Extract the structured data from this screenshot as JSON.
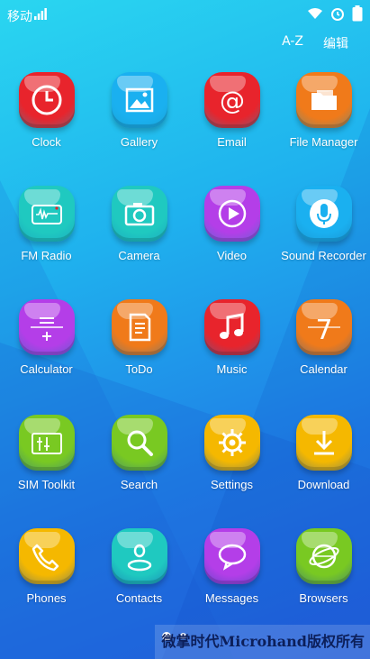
{
  "status_bar": {
    "carrier": "移动",
    "icons": [
      "signal-icon",
      "wifi-icon",
      "alarm-icon",
      "battery-icon"
    ]
  },
  "header": {
    "sort_label": "A-Z",
    "edit_label": "编辑"
  },
  "apps": [
    {
      "label": "Clock",
      "color": "#e8242c",
      "icon": "clock-icon"
    },
    {
      "label": "Gallery",
      "color": "#1ab0f0",
      "icon": "gallery-icon"
    },
    {
      "label": "Email",
      "color": "#e8242c",
      "icon": "email-icon"
    },
    {
      "label": "File Manager",
      "color": "#f07a1a",
      "icon": "folder-icon"
    },
    {
      "label": "FM Radio",
      "color": "#1fc9c0",
      "icon": "radio-icon"
    },
    {
      "label": "Camera",
      "color": "#1fc9c0",
      "icon": "camera-icon"
    },
    {
      "label": "Video",
      "color": "#b43ee8",
      "icon": "play-icon"
    },
    {
      "label": "Sound Recorder",
      "color": "#1ab0f0",
      "icon": "microphone-icon"
    },
    {
      "label": "Calculator",
      "color": "#b43ee8",
      "icon": "calculator-icon"
    },
    {
      "label": "ToDo",
      "color": "#f07a1a",
      "icon": "note-icon"
    },
    {
      "label": "Music",
      "color": "#e8242c",
      "icon": "music-icon"
    },
    {
      "label": "Calendar",
      "color": "#f07a1a",
      "icon": "calendar-icon"
    },
    {
      "label": "SIM Toolkit",
      "color": "#79c922",
      "icon": "sim-icon"
    },
    {
      "label": "Search",
      "color": "#79c922",
      "icon": "search-icon"
    },
    {
      "label": "Settings",
      "color": "#f5b800",
      "icon": "gear-icon"
    },
    {
      "label": "Download",
      "color": "#f5b800",
      "icon": "download-icon"
    },
    {
      "label": "Phones",
      "color": "#f5b800",
      "icon": "phone-icon"
    },
    {
      "label": "Contacts",
      "color": "#1fc9c0",
      "icon": "contact-icon"
    },
    {
      "label": "Messages",
      "color": "#b43ee8",
      "icon": "message-icon"
    },
    {
      "label": "Browsers",
      "color": "#79c922",
      "icon": "globe-icon"
    }
  ],
  "calendar_day": "7",
  "page_indicator": {
    "pages": 2,
    "current": 1
  },
  "watermark": "微掌时代Microhand版权所有"
}
